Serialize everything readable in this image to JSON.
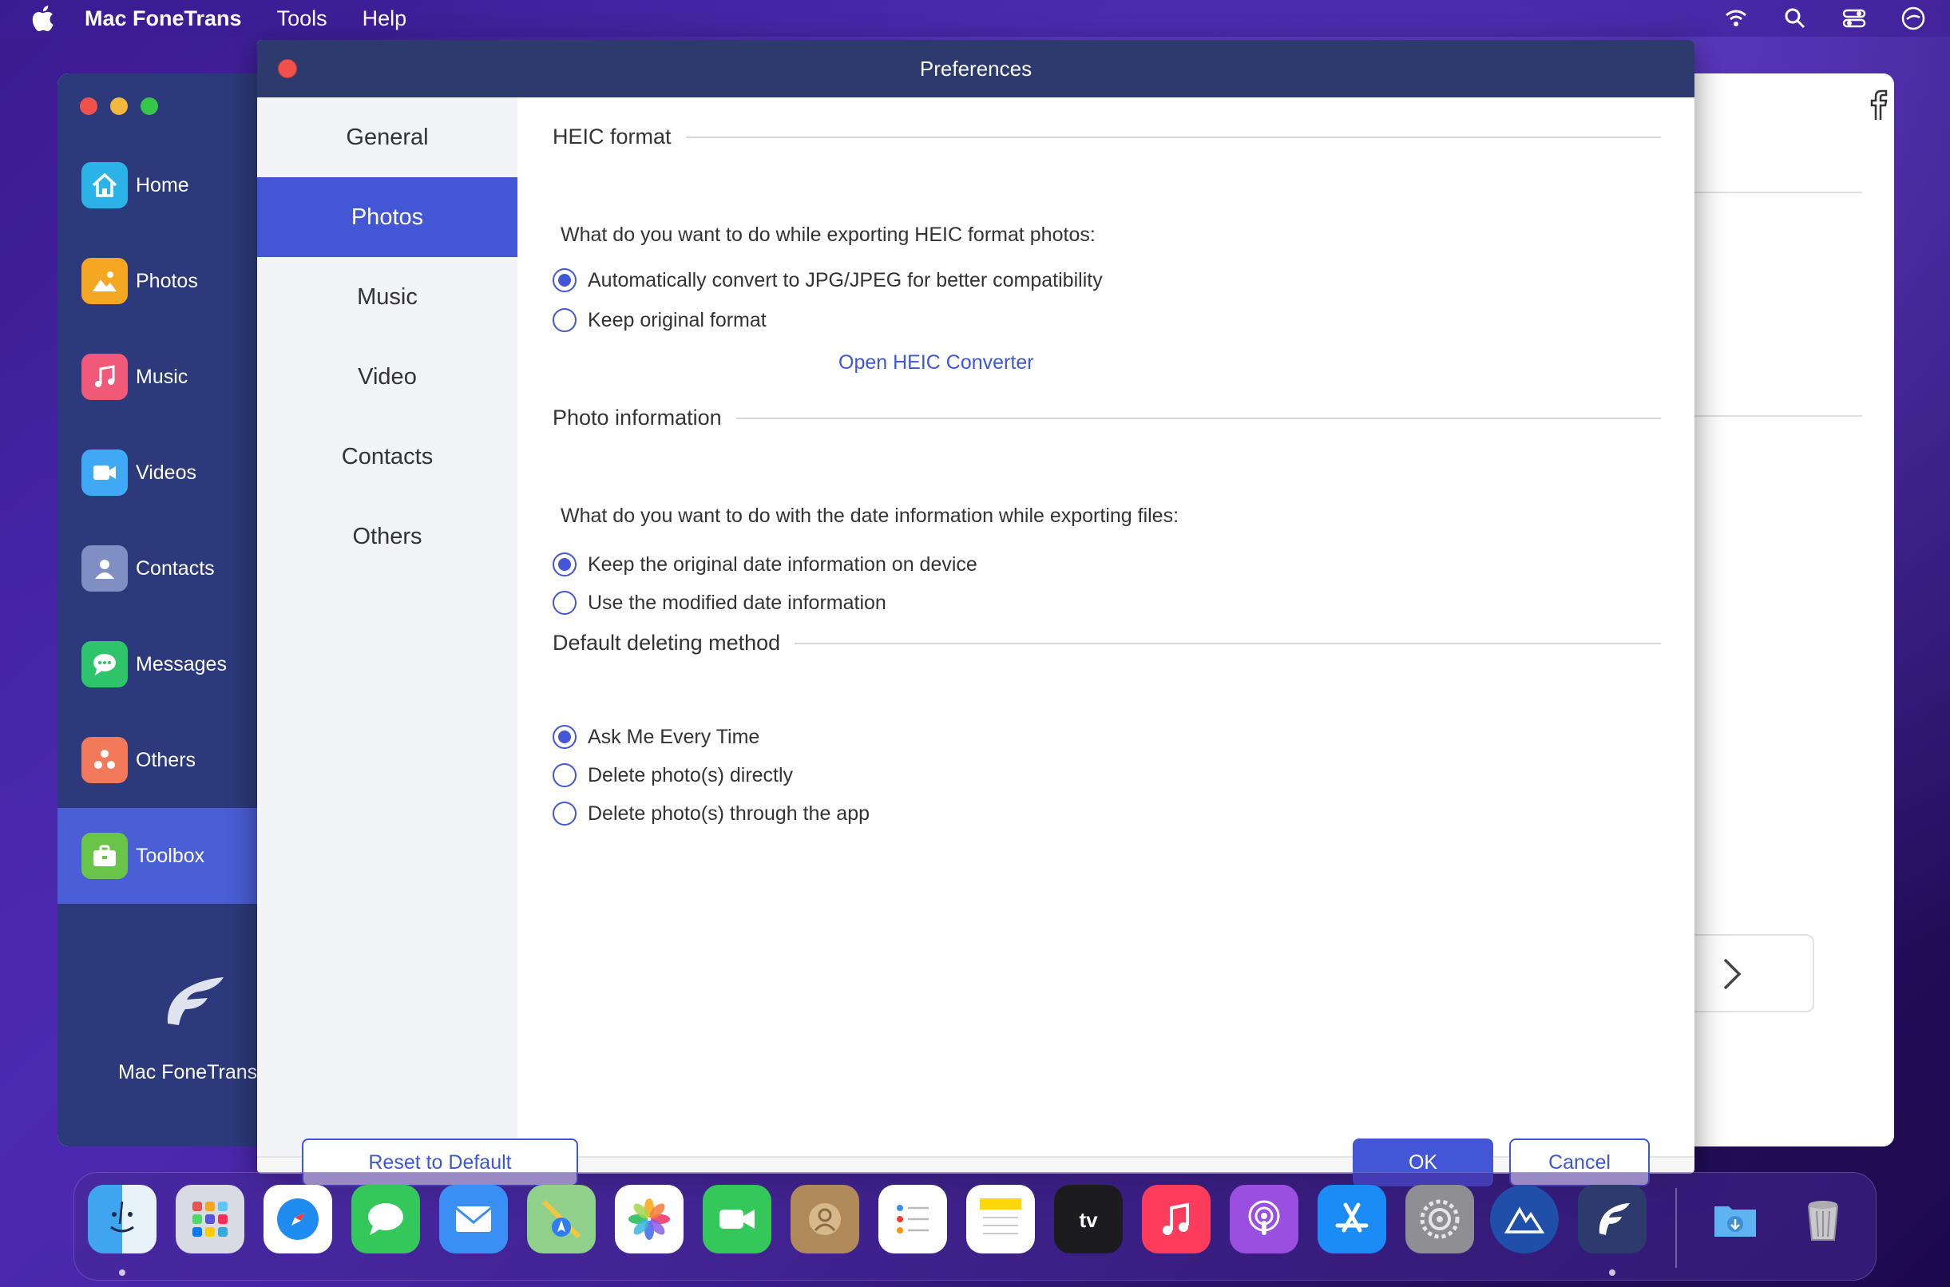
{
  "menubar": {
    "app_name": "Mac FoneTrans",
    "menus": [
      "Tools",
      "Help"
    ]
  },
  "app": {
    "sidebar": {
      "items": [
        {
          "label": "Home",
          "icon": "home-icon",
          "color": "#2bb3e8"
        },
        {
          "label": "Photos",
          "icon": "photos-icon",
          "color": "#f5a623"
        },
        {
          "label": "Music",
          "icon": "music-icon",
          "color": "#f05a78"
        },
        {
          "label": "Videos",
          "icon": "videos-icon",
          "color": "#3fa9f5"
        },
        {
          "label": "Contacts",
          "icon": "contacts-icon",
          "color": "#7f8fc4"
        },
        {
          "label": "Messages",
          "icon": "messages-icon",
          "color": "#2ec46a"
        },
        {
          "label": "Others",
          "icon": "others-icon",
          "color": "#f27a5a"
        },
        {
          "label": "Toolbox",
          "icon": "toolbox-icon",
          "color": "#6bc44a"
        }
      ],
      "active": "Toolbox",
      "brand_name": "Mac FoneTrans"
    }
  },
  "dialog": {
    "title": "Preferences",
    "tabs": [
      "General",
      "Photos",
      "Music",
      "Video",
      "Contacts",
      "Others"
    ],
    "active_tab": "Photos",
    "sections": {
      "heic": {
        "title": "HEIC format",
        "question": "What do you want to do while exporting HEIC format photos:",
        "options": [
          "Automatically convert to JPG/JPEG for better compatibility",
          "Keep original format"
        ],
        "selected": 0,
        "link": "Open HEIC Converter"
      },
      "photo_info": {
        "title": "Photo information",
        "question": "What do you want to do with the date information while exporting files:",
        "options": [
          "Keep the original date information on device",
          "Use the modified date information"
        ],
        "selected": 0
      },
      "deleting": {
        "title": "Default deleting method",
        "options": [
          "Ask Me Every Time",
          "Delete photo(s) directly",
          "Delete photo(s) through the app"
        ],
        "selected": 0
      }
    },
    "buttons": {
      "reset": "Reset to Default",
      "ok": "OK",
      "cancel": "Cancel"
    }
  },
  "dock": {
    "apps": [
      "finder-icon",
      "launchpad-icon",
      "safari-icon",
      "messages-icon",
      "mail-icon",
      "maps-icon",
      "photos-icon",
      "facetime-icon",
      "contacts-icon",
      "reminders-icon",
      "notes-icon",
      "apple-tv-icon",
      "music-icon",
      "podcasts-icon",
      "app-store-icon",
      "system-preferences-icon",
      "app-icon-mountain",
      "fonetrans-icon",
      "downloads-folder-icon",
      "trash-icon"
    ],
    "tv_label": "tv"
  },
  "colors": {
    "accent": "#4356d6",
    "titlebar": "#2c3a6e",
    "sidebar": "#2c3a7c",
    "link": "#3d57d8"
  }
}
